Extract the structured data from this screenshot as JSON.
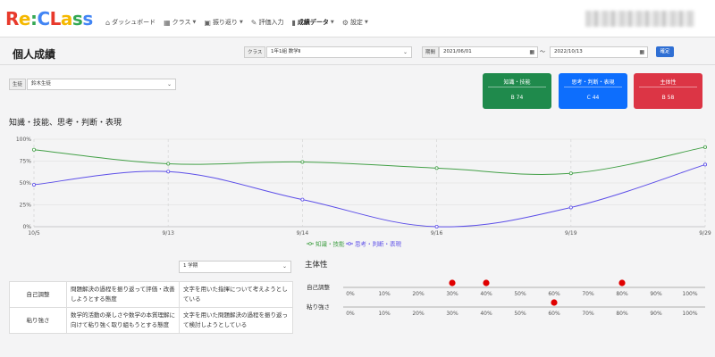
{
  "header": {
    "logo_parts": [
      {
        "text": "R",
        "color": "#e83a2c"
      },
      {
        "text": "e",
        "color": "#f5b800"
      },
      {
        "text": ":",
        "color": "#34a853"
      },
      {
        "text": "C",
        "color": "#4285f4"
      },
      {
        "text": "L",
        "color": "#e83a2c"
      },
      {
        "text": "a",
        "color": "#f5b800"
      },
      {
        "text": "s",
        "color": "#34a853"
      },
      {
        "text": "s",
        "color": "#4285f4"
      }
    ],
    "nav": [
      {
        "icon": "home-icon",
        "glyph": "⌂",
        "label": "ダッシュボード",
        "caret": false
      },
      {
        "icon": "class-icon",
        "glyph": "▦",
        "label": "クラス",
        "caret": true
      },
      {
        "icon": "reflection-icon",
        "glyph": "▣",
        "label": "振り返り",
        "caret": true
      },
      {
        "icon": "pencil-icon",
        "glyph": "✎",
        "label": "評価入力",
        "caret": false
      },
      {
        "icon": "chart-icon",
        "glyph": "▮",
        "label": "成績データ",
        "caret": true,
        "active": true
      },
      {
        "icon": "gear-icon",
        "glyph": "⚙",
        "label": "設定",
        "caret": true
      }
    ]
  },
  "filters": {
    "page_title": "個人成績",
    "class_label": "クラス",
    "class_value": "1年1組 数学Ⅱ",
    "period_label": "期間",
    "date_from": "2021/06/01",
    "tilde": "〜",
    "date_to": "2022/10/13",
    "confirm_label": "確定",
    "student_label": "生徒",
    "student_value": "鈴木生徒"
  },
  "cards": [
    {
      "title": "知識・技能",
      "value": "B  74",
      "color": "#1f8a4c"
    },
    {
      "title": "思考・判断・表現",
      "value": "C  44",
      "color": "#0d6efd"
    },
    {
      "title": "主体性",
      "value": "B  58",
      "color": "#dc3545"
    }
  ],
  "section_title": "知識・技能、思考・判断・表現",
  "chart_data": {
    "type": "line",
    "x": [
      "10/5",
      "9/13",
      "9/14",
      "9/16",
      "9/19",
      "9/29"
    ],
    "yticks": [
      "0%",
      "25%",
      "50%",
      "75%",
      "100%"
    ],
    "ylim": [
      0,
      100
    ],
    "series": [
      {
        "name": "知識・技能",
        "color": "#43a047",
        "values": [
          88,
          72,
          74,
          67,
          61,
          91
        ]
      },
      {
        "name": "思考・判断・表現",
        "color": "#5c4ee8",
        "values": [
          48,
          63,
          31,
          0,
          22,
          71
        ]
      }
    ],
    "grid": true,
    "legend_position": "bottom"
  },
  "reflection": {
    "term_value": "1 学期",
    "rows": [
      {
        "label": "自己調整",
        "criterion": "問題解決の過程を振り返って評価・改善しようとする態度",
        "comment": "文字を用いた指揮について考えようとしている"
      },
      {
        "label": "粘り強さ",
        "criterion": "数学的活動の楽しさや数学の本質理解に向けて粘り強く取り組もうとする態度",
        "comment": "文字を用いた問題解決の過程を振り返って検討しようとしている"
      }
    ]
  },
  "attitude": {
    "title": "主体性",
    "ticks": [
      "0%",
      "10%",
      "20%",
      "30%",
      "40%",
      "50%",
      "60%",
      "70%",
      "80%",
      "90%",
      "100%"
    ],
    "rows": [
      {
        "label": "自己調整",
        "points": [
          30,
          40,
          80
        ]
      },
      {
        "label": "粘り強さ",
        "points": [
          60
        ]
      }
    ],
    "dot_color": "#e00000"
  }
}
